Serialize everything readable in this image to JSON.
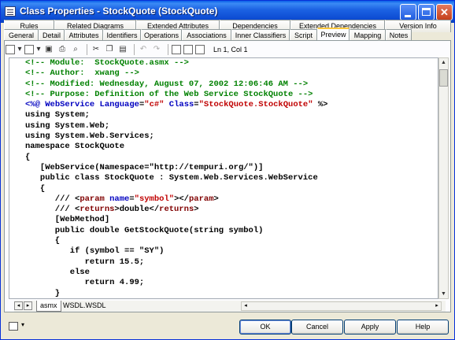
{
  "window": {
    "title": "Class Properties - StockQuote (StockQuote)"
  },
  "tabs": {
    "row1": [
      {
        "label": "Rules"
      },
      {
        "label": "Related Diagrams"
      },
      {
        "label": "Extended Attributes"
      },
      {
        "label": "Dependencies"
      },
      {
        "label": "Extended Dependencies"
      },
      {
        "label": "Version Info"
      }
    ],
    "row2": [
      {
        "label": "General"
      },
      {
        "label": "Detail"
      },
      {
        "label": "Attributes"
      },
      {
        "label": "Identifiers"
      },
      {
        "label": "Operations"
      },
      {
        "label": "Associations"
      },
      {
        "label": "Inner Classifiers"
      },
      {
        "label": "Script"
      },
      {
        "label": "Preview"
      },
      {
        "label": "Mapping"
      },
      {
        "label": "Notes"
      }
    ],
    "active": "Preview"
  },
  "toolbar": {
    "position": "Ln 1, Col 1"
  },
  "code": {
    "lines": [
      [
        {
          "t": "<!-- Module:  StockQuote.asmx -->",
          "c": "c-comment"
        }
      ],
      [
        {
          "t": "<!-- Author:  xwang -->",
          "c": "c-comment"
        }
      ],
      [
        {
          "t": "<!-- Modified: Wednesday, August 07, 2002 12:06:46 AM -->",
          "c": "c-comment"
        }
      ],
      [
        {
          "t": "<!-- Purpose: Definition of the Web Service StockQuote -->",
          "c": "c-comment"
        }
      ],
      [
        {
          "t": "<%@ ",
          "c": "c-dir"
        },
        {
          "t": "WebService ",
          "c": "c-dir"
        },
        {
          "t": "Language",
          "c": "c-kw"
        },
        {
          "t": "=",
          "c": "c-plain"
        },
        {
          "t": "\"c#\"",
          "c": "c-str"
        },
        {
          "t": " Class",
          "c": "c-kw"
        },
        {
          "t": "=",
          "c": "c-plain"
        },
        {
          "t": "\"StockQuote.StockQuote\"",
          "c": "c-str"
        },
        {
          "t": " %>",
          "c": "c-plain"
        }
      ],
      [
        {
          "t": "using System;",
          "c": "c-plain"
        }
      ],
      [
        {
          "t": "using System.Web;",
          "c": "c-plain"
        }
      ],
      [
        {
          "t": "using System.Web.Services;",
          "c": "c-plain"
        }
      ],
      [
        {
          "t": "namespace StockQuote",
          "c": "c-plain"
        }
      ],
      [
        {
          "t": "{",
          "c": "c-plain"
        }
      ],
      [
        {
          "t": "   [WebService(Namespace=\"http://tempuri.org/\")]",
          "c": "c-plain"
        }
      ],
      [
        {
          "t": "   public class StockQuote : System.Web.Services.WebService",
          "c": "c-plain"
        }
      ],
      [
        {
          "t": "   {",
          "c": "c-plain"
        }
      ],
      [
        {
          "t": "      /// <",
          "c": "c-plain"
        },
        {
          "t": "param",
          "c": "c-attr"
        },
        {
          "t": " name",
          "c": "c-kw"
        },
        {
          "t": "=",
          "c": "c-plain"
        },
        {
          "t": "\"symbol\"",
          "c": "c-str"
        },
        {
          "t": "></",
          "c": "c-plain"
        },
        {
          "t": "param",
          "c": "c-attr"
        },
        {
          "t": ">",
          "c": "c-plain"
        }
      ],
      [
        {
          "t": "      /// <",
          "c": "c-plain"
        },
        {
          "t": "returns",
          "c": "c-attr"
        },
        {
          "t": ">double</",
          "c": "c-plain"
        },
        {
          "t": "returns",
          "c": "c-attr"
        },
        {
          "t": ">",
          "c": "c-plain"
        }
      ],
      [
        {
          "t": "      [WebMethod]",
          "c": "c-plain"
        }
      ],
      [
        {
          "t": "      public double GetStockQuote(string symbol)",
          "c": "c-plain"
        }
      ],
      [
        {
          "t": "      {",
          "c": "c-plain"
        }
      ],
      [
        {
          "t": "         if (symbol == \"SY\")",
          "c": "c-plain"
        }
      ],
      [
        {
          "t": "            return 15.5;",
          "c": "c-plain"
        }
      ],
      [
        {
          "t": "         else",
          "c": "c-plain"
        }
      ],
      [
        {
          "t": "            return 4.99;",
          "c": "c-plain"
        }
      ],
      [
        {
          "t": "      }",
          "c": "c-plain"
        }
      ],
      [
        {
          "t": "   }",
          "c": "c-plain"
        }
      ],
      [
        {
          "t": "}",
          "c": "c-plain"
        }
      ]
    ]
  },
  "subtabs": [
    {
      "label": "asmx"
    },
    {
      "label": "WSDL.WSDL"
    }
  ],
  "buttons": {
    "ok": "OK",
    "cancel": "Cancel",
    "apply": "Apply",
    "help": "Help"
  },
  "colors": {
    "comment": "#008000",
    "keyword": "#0000c0",
    "string": "#c00000",
    "titlebar": "#0a48d0"
  }
}
